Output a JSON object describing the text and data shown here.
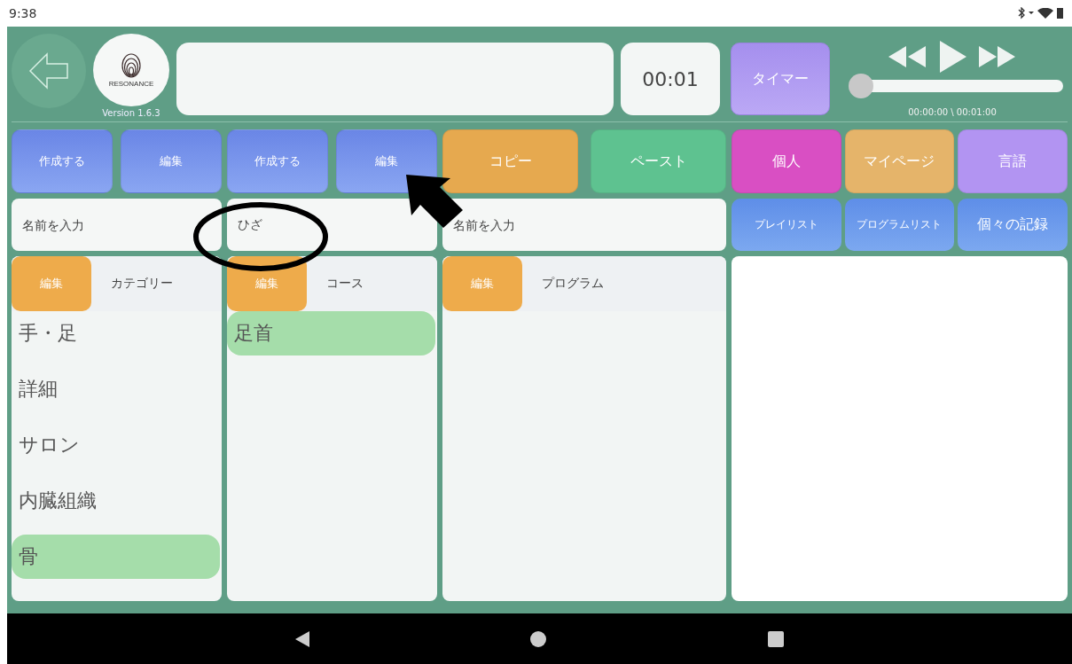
{
  "status_bar": {
    "time": "9:38"
  },
  "header": {
    "logo_text": "RESONANCE",
    "version": "Version 1.6.3",
    "elapsed": "00:01",
    "timer_button": "タイマー",
    "player": {
      "level": 0,
      "time_reading": "00:00:00 \\ 00:01:00"
    }
  },
  "toolbar": [
    {
      "label": "作成する",
      "kind": "blue"
    },
    {
      "label": "編集",
      "kind": "blue"
    },
    {
      "label": "作成する",
      "kind": "blue"
    },
    {
      "label": "編集",
      "kind": "blue"
    },
    {
      "label": "コピー",
      "kind": "orange"
    },
    {
      "label": "ペースト",
      "kind": "green"
    },
    {
      "label": "個人",
      "kind": "magenta"
    },
    {
      "label": "マイページ",
      "kind": "tan"
    },
    {
      "label": "言語",
      "kind": "purple"
    }
  ],
  "search_fields": [
    {
      "placeholder": "名前を入力"
    },
    {
      "value": "ひざ"
    },
    {
      "placeholder": "名前を入力"
    }
  ],
  "list_buttons": [
    "プレイリスト",
    "プログラムリスト",
    "個々の記録"
  ],
  "panels": [
    {
      "edit_button": "編集",
      "title": "カテゴリー",
      "items": [
        {
          "label": "手・足",
          "selected": false
        },
        {
          "label": "詳細",
          "selected": false
        },
        {
          "label": "サロン",
          "selected": false
        },
        {
          "label": "内臓組織",
          "selected": false
        },
        {
          "label": "骨",
          "selected": true
        }
      ]
    },
    {
      "edit_button": "編集",
      "title": "コース",
      "items": [
        {
          "label": "足首",
          "selected": true
        }
      ]
    },
    {
      "edit_button": "編集",
      "title": "プログラム"
    }
  ]
}
